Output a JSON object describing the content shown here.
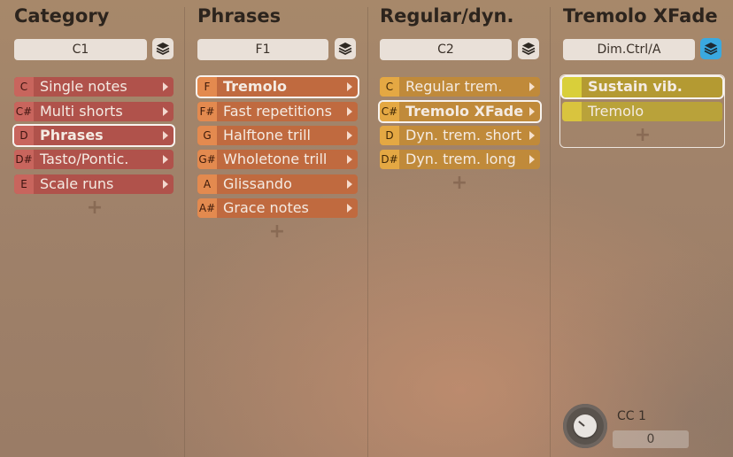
{
  "columns": [
    {
      "title": "Category",
      "selector": "C1",
      "items": [
        {
          "key": "C",
          "label": "Single notes"
        },
        {
          "key": "C#",
          "label": "Multi shorts"
        },
        {
          "key": "D",
          "label": "Phrases",
          "selected": true
        },
        {
          "key": "D#",
          "label": "Tasto/Pontic."
        },
        {
          "key": "E",
          "label": "Scale runs"
        }
      ]
    },
    {
      "title": "Phrases",
      "selector": "F1",
      "items": [
        {
          "key": "F",
          "label": "Tremolo",
          "selected": true
        },
        {
          "key": "F#",
          "label": "Fast repetitions"
        },
        {
          "key": "G",
          "label": "Halftone trill"
        },
        {
          "key": "G#",
          "label": "Wholetone trill"
        },
        {
          "key": "A",
          "label": "Glissando"
        },
        {
          "key": "A#",
          "label": "Grace notes"
        }
      ]
    },
    {
      "title": "Regular/dyn.",
      "selector": "C2",
      "items": [
        {
          "key": "C",
          "label": "Regular trem."
        },
        {
          "key": "C#",
          "label": "Tremolo XFade",
          "selected": true
        },
        {
          "key": "D",
          "label": "Dyn. trem. short"
        },
        {
          "key": "D#",
          "label": "Dyn. trem. long"
        }
      ]
    },
    {
      "title": "Tremolo XFade",
      "selector": "Dim.Ctrl/A",
      "items": [
        {
          "label": "Sustain vib.",
          "selected": true
        },
        {
          "label": "Tremolo"
        }
      ]
    }
  ],
  "add_symbol": "+",
  "cc": {
    "label": "CC 1",
    "value": "0"
  },
  "colors": {
    "category": "#b0524b",
    "phrases": "#c06a3f",
    "regular": "#c08a3a",
    "xfade": "#b49a32",
    "layer_active": "#3aa9e0"
  },
  "icons": {
    "layer": "layers-icon",
    "arrow": "chevron-right-icon",
    "knob": "knob-icon"
  }
}
